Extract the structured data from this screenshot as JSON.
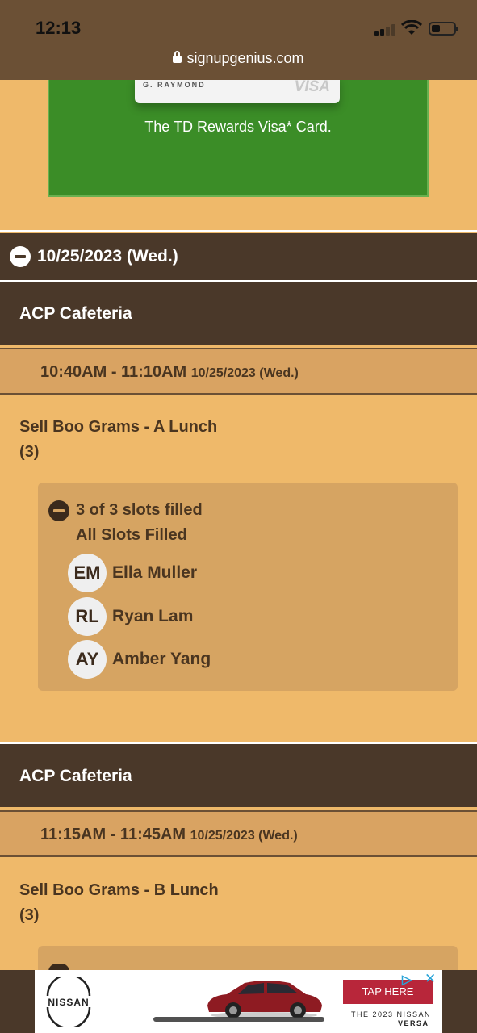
{
  "status_bar": {
    "time": "12:13"
  },
  "browser": {
    "url": "signupgenius.com"
  },
  "top_ad": {
    "card_name": "G. RAYMOND",
    "card_brand": "VISA",
    "text": "The TD Rewards Visa* Card."
  },
  "date_header": {
    "label": "10/25/2023 (Wed.)"
  },
  "sections": [
    {
      "location": "ACP Cafeteria",
      "time": "10:40AM - 11:10AM",
      "date": "10/25/2023 (Wed.)",
      "task": "Sell Boo Grams - A Lunch",
      "qty": "(3)",
      "slots_status": "3 of 3 slots filled",
      "slots_sub": "All Slots Filled",
      "people": [
        {
          "initials": "EM",
          "name": "Ella Muller"
        },
        {
          "initials": "RL",
          "name": "Ryan Lam"
        },
        {
          "initials": "AY",
          "name": "Amber Yang"
        }
      ]
    },
    {
      "location": "ACP Cafeteria",
      "time": "11:15AM - 11:45AM",
      "date": "10/25/2023 (Wed.)",
      "task": "Sell Boo Grams - B Lunch",
      "qty": "(3)"
    }
  ],
  "bottom_ad": {
    "brand": "NISSAN",
    "cta": "TAP HERE",
    "line1": "THE 2023 NISSAN",
    "line2": "VERSA"
  },
  "colors": {
    "page_bg": "#efb96a",
    "header_brown": "#4a3829",
    "slot_box": "#d6a462",
    "ad_green": "#3b8d27"
  }
}
